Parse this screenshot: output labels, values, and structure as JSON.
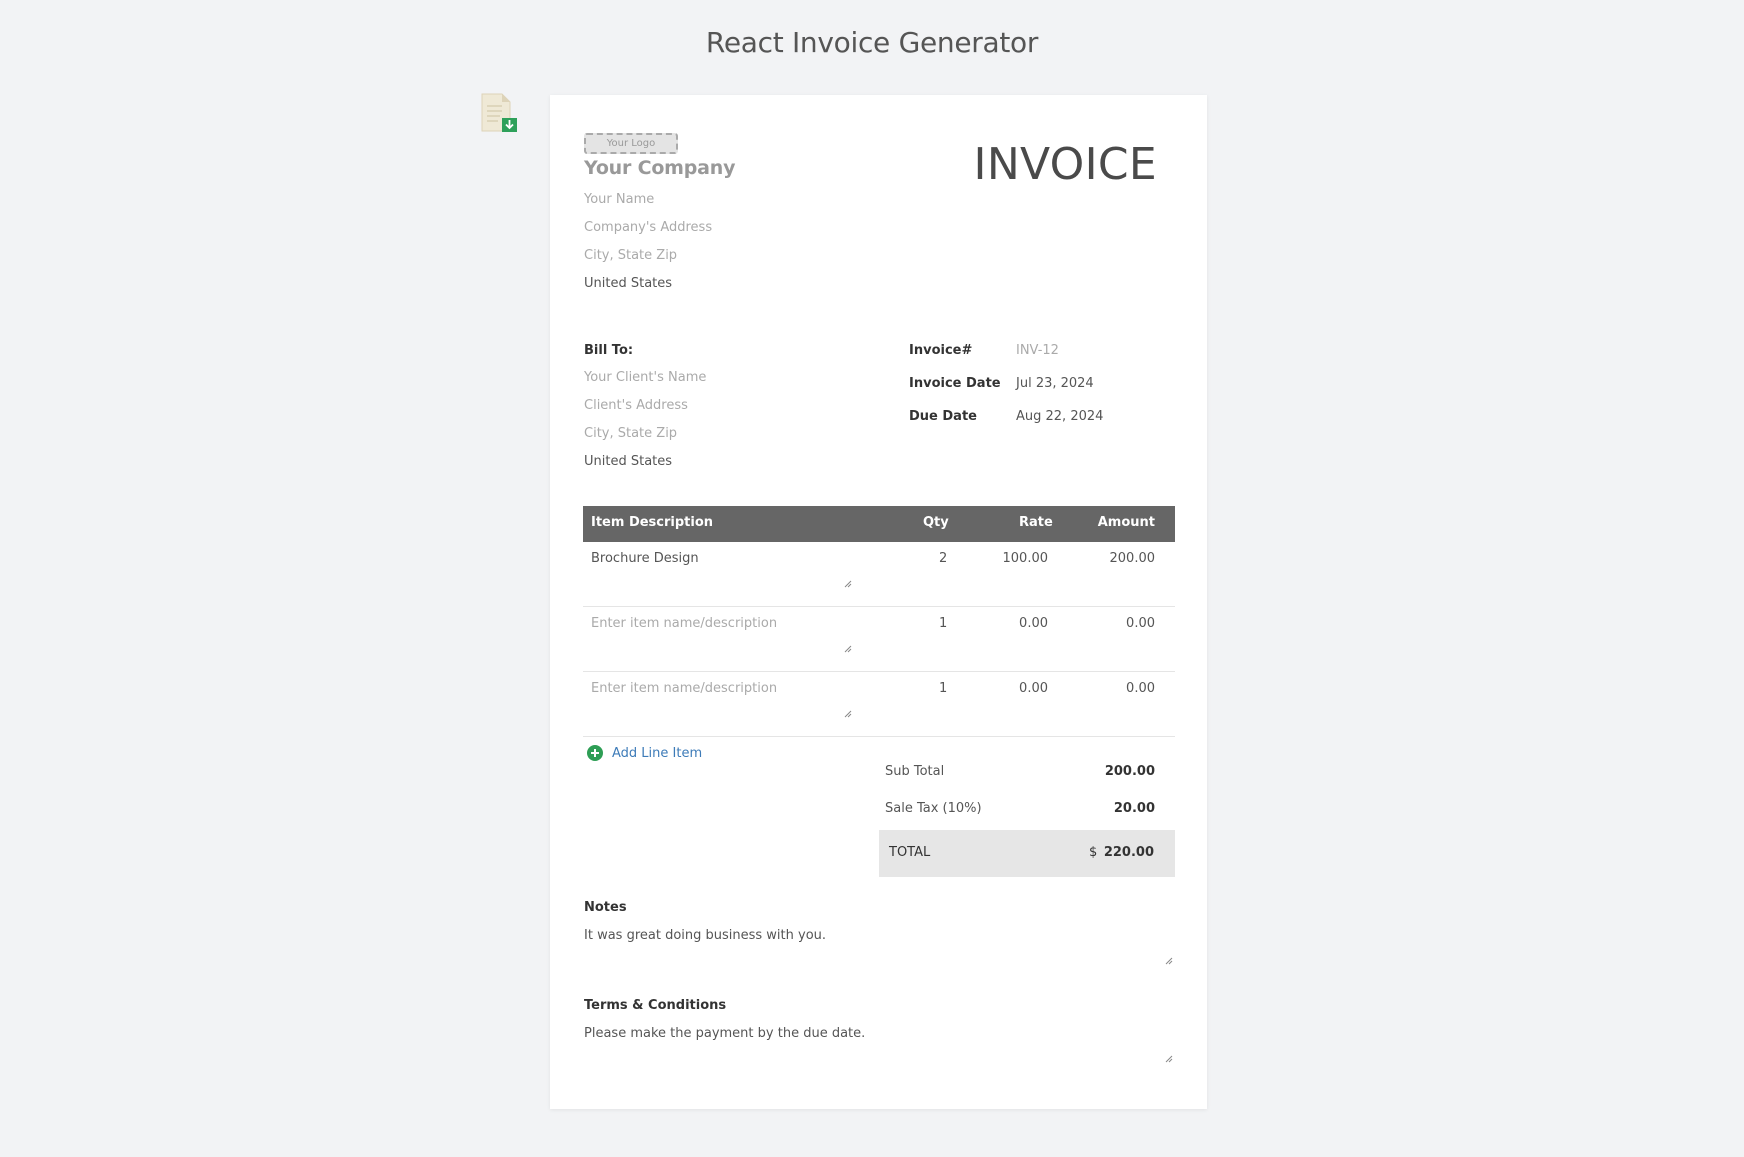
{
  "app": {
    "title": "React Invoice Generator"
  },
  "company": {
    "logo_placeholder": "Your Logo",
    "name": "Your Company",
    "your_name": "Your Name",
    "address": "Company's Address",
    "city": "City, State Zip",
    "country": "United States"
  },
  "invoice_title": "INVOICE",
  "bill_to": {
    "label": "Bill To:",
    "client_name": "Your Client's Name",
    "address": "Client's Address",
    "city": "City, State Zip",
    "country": "United States"
  },
  "meta": {
    "number_label": "Invoice#",
    "number_value": "INV-12",
    "date_label": "Invoice Date",
    "date_value": "Jul 23, 2024",
    "due_label": "Due Date",
    "due_value": "Aug 22, 2024"
  },
  "table": {
    "headers": {
      "description": "Item Description",
      "qty": "Qty",
      "rate": "Rate",
      "amount": "Amount"
    },
    "rows": [
      {
        "description": "Brochure Design",
        "qty": "2",
        "rate": "100.00",
        "amount": "200.00"
      },
      {
        "description": "Enter item name/description",
        "qty": "1",
        "rate": "0.00",
        "amount": "0.00"
      },
      {
        "description": "Enter item name/description",
        "qty": "1",
        "rate": "0.00",
        "amount": "0.00"
      }
    ]
  },
  "add_line_item": "Add Line Item",
  "summary": {
    "subtotal_label": "Sub Total",
    "subtotal_value": "200.00",
    "tax_label": "Sale Tax (10%)",
    "tax_value": "20.00",
    "total_label": "TOTAL",
    "currency": "$",
    "total_value": "220.00"
  },
  "notes": {
    "label": "Notes",
    "text": "It was great doing business with you."
  },
  "terms": {
    "label": "Terms & Conditions",
    "text": "Please make the payment by the due date."
  },
  "icons": {
    "download": "download-pdf-icon",
    "add": "plus-circle-icon",
    "resize": "resize-handle-icon"
  },
  "colors": {
    "header_bg": "#666666",
    "add_icon": "#2e9e55",
    "link": "#3d7bb8",
    "total_bg": "#e6e6e6"
  }
}
